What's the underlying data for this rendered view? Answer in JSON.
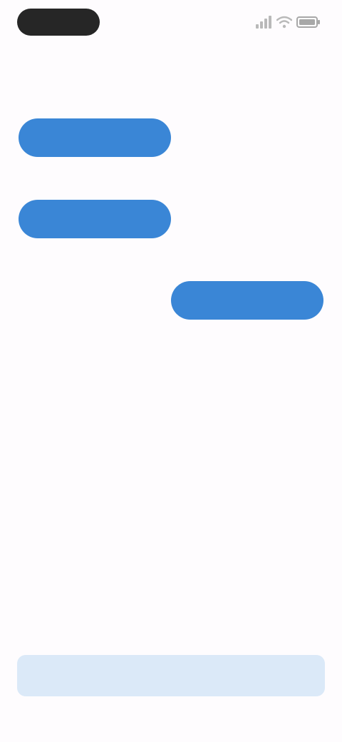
{
  "status_bar": {
    "time": "",
    "icons": [
      "signal-icon",
      "wifi-icon",
      "battery-icon"
    ]
  },
  "page": {
    "heading": ""
  },
  "rows": [
    {
      "button_label": "",
      "side_label": ""
    },
    {
      "button_label": "",
      "side_label": ""
    },
    {
      "button_label": "",
      "side_label": ""
    }
  ],
  "bottom_bar": {
    "label": ""
  },
  "colors": {
    "background": "#fefcfe",
    "accent": "#3a86d6",
    "accent_light": "#dbe9f8",
    "status_pill": "#262626",
    "muted_text": "#8a8a8a"
  }
}
